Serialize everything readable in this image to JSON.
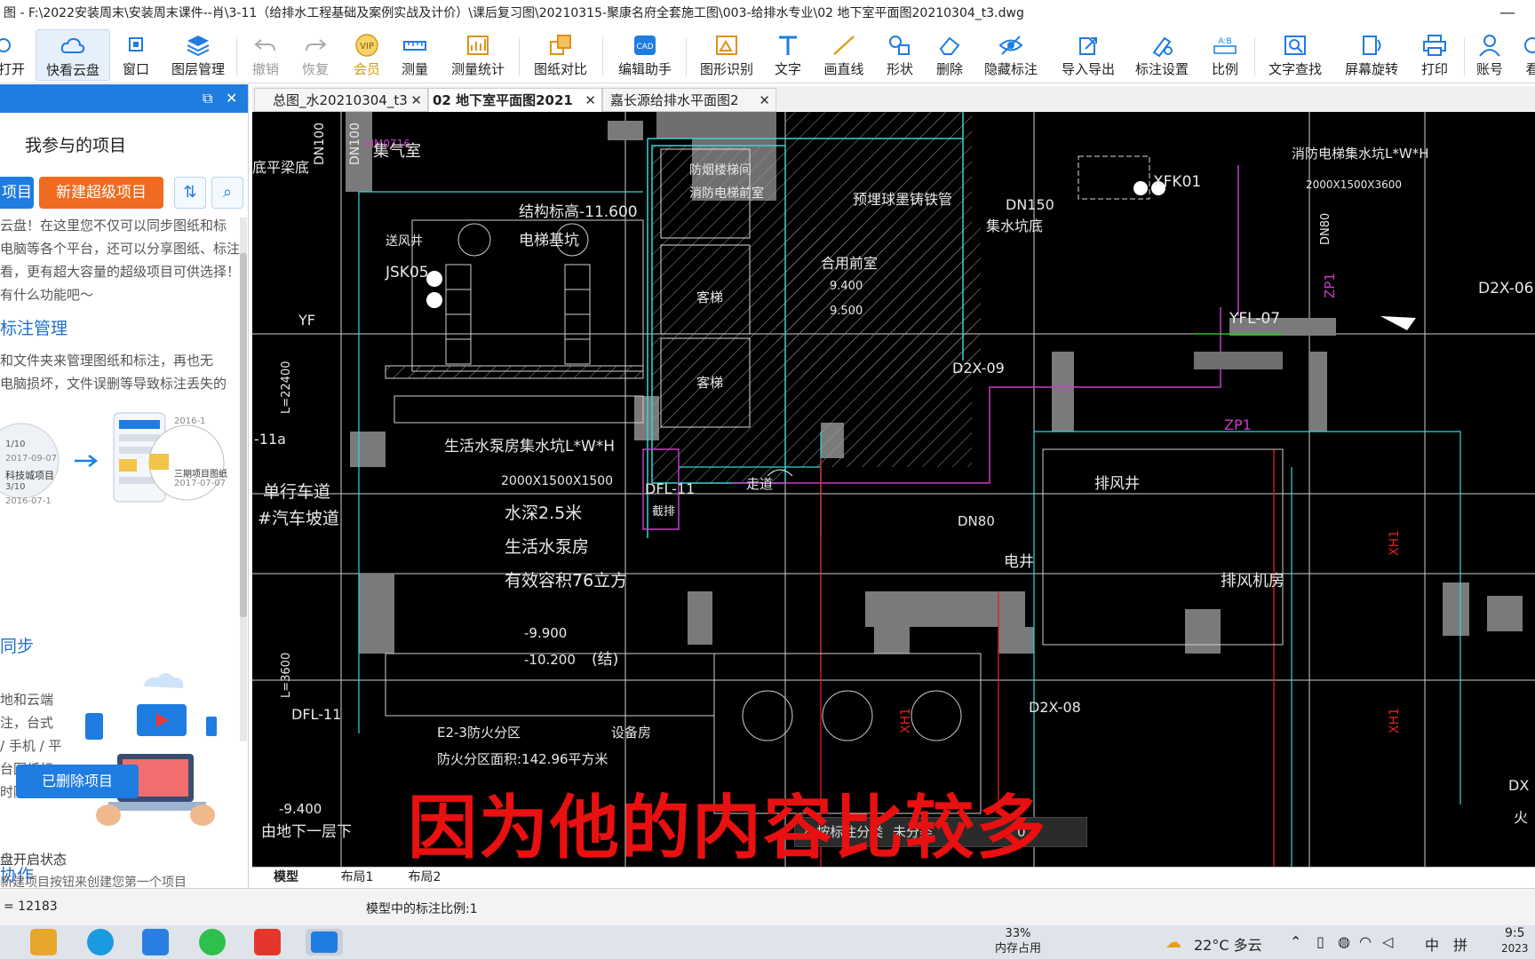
{
  "window": {
    "title": "图 - F:\\2022安装周末\\安装周末课件--肖\\3-11（给排水工程基础及案例实战及计价）\\课后复习图\\20210315-聚康名府全套施工图\\003-给排水专业\\02 地下室平面图20210304_t3.dwg",
    "minimize_label": "—"
  },
  "toolbar": [
    {
      "label": "打开",
      "icon": "folder-icon"
    },
    {
      "label": "快看云盘",
      "icon": "cloud-icon"
    },
    {
      "label": "窗口",
      "icon": "window-icon"
    },
    {
      "label": "图层管理",
      "icon": "layers-icon"
    },
    {
      "label": "撤销",
      "icon": "undo-icon"
    },
    {
      "label": "恢复",
      "icon": "redo-icon"
    },
    {
      "label": "会员",
      "icon": "vip-icon"
    },
    {
      "label": "测量",
      "icon": "ruler-icon"
    },
    {
      "label": "测量统计",
      "icon": "stats-icon"
    },
    {
      "label": "图纸对比",
      "icon": "compare-icon"
    },
    {
      "label": "编辑助手",
      "icon": "cad-icon"
    },
    {
      "label": "图形识别",
      "icon": "recognize-icon"
    },
    {
      "label": "文字",
      "icon": "text-icon"
    },
    {
      "label": "画直线",
      "icon": "line-icon"
    },
    {
      "label": "形状",
      "icon": "shape-icon"
    },
    {
      "label": "删除",
      "icon": "eraser-icon"
    },
    {
      "label": "隐藏标注",
      "icon": "eye-hide-icon"
    },
    {
      "label": "导入导出",
      "icon": "export-icon"
    },
    {
      "label": "标注设置",
      "icon": "annotate-settings-icon"
    },
    {
      "label": "比例",
      "icon": "scale-icon"
    },
    {
      "label": "文字查找",
      "icon": "text-search-icon"
    },
    {
      "label": "屏幕旋转",
      "icon": "rotate-icon"
    },
    {
      "label": "打印",
      "icon": "printer-icon"
    },
    {
      "label": "账号",
      "icon": "user-icon"
    },
    {
      "label": "看",
      "icon": "view-icon"
    }
  ],
  "panel": {
    "restore_icon": "⧉",
    "close_icon": "✕",
    "title": "我参与的项目",
    "project_button": "项目",
    "new_button": "新建超级项目",
    "lines": [
      "云盘！在这里您不仅可以同步图纸和标",
      "电脑等各个平台，还可以分享图纸、标注",
      "看，更有超大容量的超级项目可供选择！",
      "有什么功能吧～"
    ],
    "section1": "标注管理",
    "section1_lines": [
      "和文件夹来管理图纸和标注，再也无",
      "电脑损坏，文件误删等导致标注丢失的"
    ],
    "card": {
      "a_date": "1/10",
      "a_name": "科技城项目",
      "a_date2": "3/10",
      "b_name": "三期项目图纸",
      "b_date": "2017-07-07",
      "top_date": "2016-1",
      "year1": "2017-09-07",
      "year2": "2016-07-1"
    },
    "section2": "同步",
    "section2_lines": [
      "地和云端",
      "注，台式",
      "/ 手机 / 平",
      "台图纸标",
      "时随地，"
    ],
    "section3": "协作",
    "delete_button": "已删除项目",
    "status1": "盘开启状态",
    "status2": "新建项目按钮来创建您第一个项目"
  },
  "tabs": [
    {
      "label": "总图_水20210304_t3"
    },
    {
      "label": "02  地下室平面图2021"
    },
    {
      "label": "嘉长源给排水平面图2"
    }
  ],
  "drawing": {
    "labels": [
      "DN100",
      "DN100",
      "HM0716",
      "集气室",
      "底平梁底",
      "结构标高-11.600",
      "电梯基坑",
      "防烟楼梯间",
      "消防电梯前室",
      "合用前室",
      "预埋球墨铸铁管",
      "DN150",
      "集水坑底",
      "9.400",
      "9.500",
      "客梯",
      "客梯",
      "JSK05",
      "YF",
      "送风井",
      "-11a",
      "L=22400",
      "D2X-09",
      "消防电梯集水坑L*W*H",
      "2000X1500X3600",
      "XFK01",
      "DN80",
      "ZP1",
      "D2X-06",
      "YFL-07",
      "ZP1",
      "生活水泵房集水坑L*W*H",
      "2000X1500X1500",
      "水深2.5米",
      "生活水泵房",
      "有效容积76立方",
      "-9.900",
      "-10.200",
      "(结)",
      "DFL-11",
      "截排",
      "走道",
      "单行车道",
      "#汽车坡道",
      "排风井",
      "DN80",
      "电井",
      "排风机房",
      "XH1",
      "XH1",
      "XH1",
      "D2X-08",
      "E2-3防火分区",
      "设备房",
      "防火分区面积:142.96平方米",
      "L=3600",
      "DFL-11",
      "-9.400",
      "由地下一层下",
      "DX",
      "火"
    ]
  },
  "caption": "因为他的内容比较多",
  "floatbar": {
    "a": "8 按标注分类",
    "b": "未分类",
    "c": "0"
  },
  "layout_tabs": [
    "模型",
    "布局1",
    "布局2"
  ],
  "status": {
    "coord": "= 12183",
    "scale": "模型中的标注比例:1"
  },
  "taskbar": {
    "memory_percent": "33%",
    "memory_label": "内存占用",
    "weather": "22°C  多云",
    "ime1": "中",
    "ime2": "拼",
    "time": "9:5",
    "date": "2023"
  },
  "colors": {
    "accent": "#1f7ce0",
    "orange": "#ef6b1f",
    "caption": "#e81010",
    "cad_bg": "#000000",
    "cyan": "#35d6d6",
    "magenta": "#c83cc8",
    "red_line": "#e02020",
    "green_line": "#27c327"
  }
}
